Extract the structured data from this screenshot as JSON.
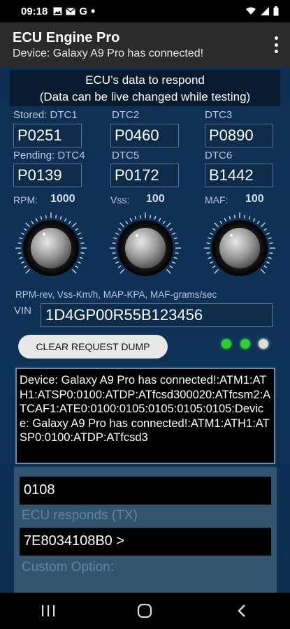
{
  "status_bar": {
    "time": "09:18",
    "left_icons": [
      "image-icon",
      "mail-icon",
      "g-icon",
      "dot-icon"
    ],
    "right_icons": [
      "wifi-icon",
      "signal-icon",
      "battery-icon"
    ]
  },
  "app_bar": {
    "title": "ECU Engine Pro",
    "subtitle": "Device: Galaxy A9 Pro has connected!"
  },
  "heading": {
    "line1": "ECU’s data to respond",
    "line2": "(Data can be live changed while testing)"
  },
  "dtc": [
    {
      "label": "Stored: DTC1",
      "value": "P0251"
    },
    {
      "label": "DTC2",
      "value": "P0460"
    },
    {
      "label": "DTC3",
      "value": "P0890"
    },
    {
      "label": "Pending: DTC4",
      "value": "P0139"
    },
    {
      "label": "DTC5",
      "value": "P0172"
    },
    {
      "label": "DTC6",
      "value": "B1442"
    }
  ],
  "gauges": [
    {
      "label": "RPM:",
      "value": "1000"
    },
    {
      "label": "Vss:",
      "value": "100"
    },
    {
      "label": "MAF:",
      "value": "100"
    }
  ],
  "units_text": "RPM-rev, Vss-Km/h, MAP-KPA, MAF-grams/sec",
  "vin": {
    "label": "VIN",
    "value": "1D4GP00R55B123456"
  },
  "clear_button": "CLEAR REQUEST DUMP",
  "leds": [
    {
      "color": "#33cc33"
    },
    {
      "color": "#33cc33"
    },
    {
      "color": "#d8e0d8"
    }
  ],
  "log_text": "Device: Galaxy A9 Pro has connected!:ATM1:ATH1:ATSP0:0100:ATDP:ATfcsd300020:ATfcsm2:ATCAF1:ATE0:0100:0105:0105:0105:0105:Device: Galaxy A9 Pro has connected!:ATM1:ATH1:ATSP0:0100:ATDP:ATfcsd3",
  "request_field": "0108",
  "ecu_responds_label": "ECU responds (TX)",
  "response_field": "7E8034108B0 >",
  "custom_option_label": "Custom Option:",
  "colors": {
    "background": "#0d3357",
    "app_bar": "#2b2b2b",
    "led_on": "#33cc33"
  }
}
